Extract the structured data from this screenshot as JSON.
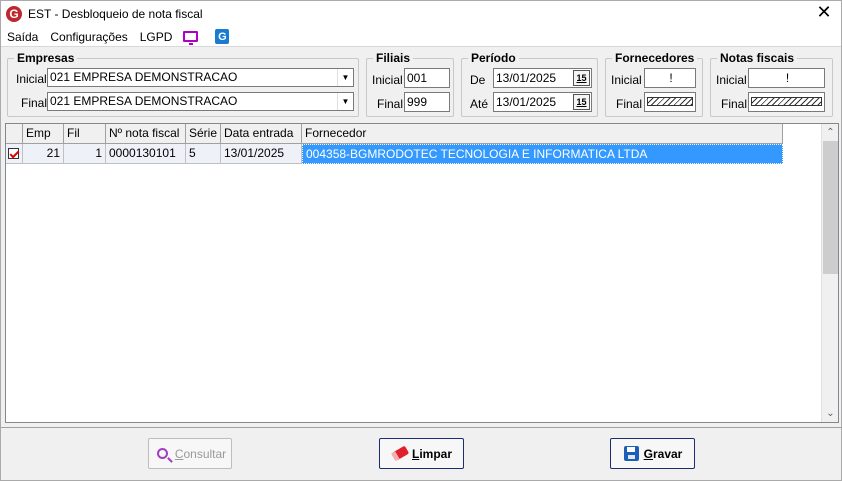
{
  "window": {
    "title": "EST - Desbloqueio de nota fiscal",
    "close": "✕"
  },
  "menu": {
    "items": [
      "Saída",
      "Configurações",
      "LGPD"
    ]
  },
  "empresas": {
    "legend": "Empresas",
    "inicial_label": "Inicial",
    "final_label": "Final",
    "inicial_value": "021 EMPRESA DEMONSTRACAO",
    "final_value": "021 EMPRESA DEMONSTRACAO"
  },
  "filiais": {
    "legend": "Filiais",
    "inicial_label": "Inicial",
    "final_label": "Final",
    "inicial_value": "001",
    "final_value": "999"
  },
  "periodo": {
    "legend": "Período",
    "de_label": "De",
    "ate_label": "Até",
    "de_value": "13/01/2025",
    "ate_value": "13/01/2025",
    "cal_label": "15"
  },
  "fornecedores": {
    "legend": "Fornecedores",
    "inicial_label": "Inicial",
    "final_label": "Final",
    "inicial_value": "!"
  },
  "notas": {
    "legend": "Notas fiscais",
    "inicial_label": "Inicial",
    "final_label": "Final",
    "inicial_value": "!"
  },
  "grid": {
    "headers": [
      "",
      "Emp",
      "Fil",
      "Nº nota fiscal",
      "Série",
      "Data entrada",
      "Fornecedor"
    ],
    "rows": [
      {
        "checked": true,
        "emp": "21",
        "fil": "1",
        "nota": "0000130101",
        "serie": "5",
        "data": "13/01/2025",
        "fornecedor": "004358-BGMRODOTEC TECNOLOGIA E INFORMATICA LTDA"
      }
    ]
  },
  "buttons": {
    "consultar_first": "C",
    "consultar_rest": "onsultar",
    "limpar_first": "L",
    "limpar_rest": "impar",
    "gravar_first": "G",
    "gravar_rest": "ravar"
  },
  "colors": {
    "selection": "#3399ff",
    "button_border": "#1a2d6e",
    "brand_red": "#c0262d"
  }
}
